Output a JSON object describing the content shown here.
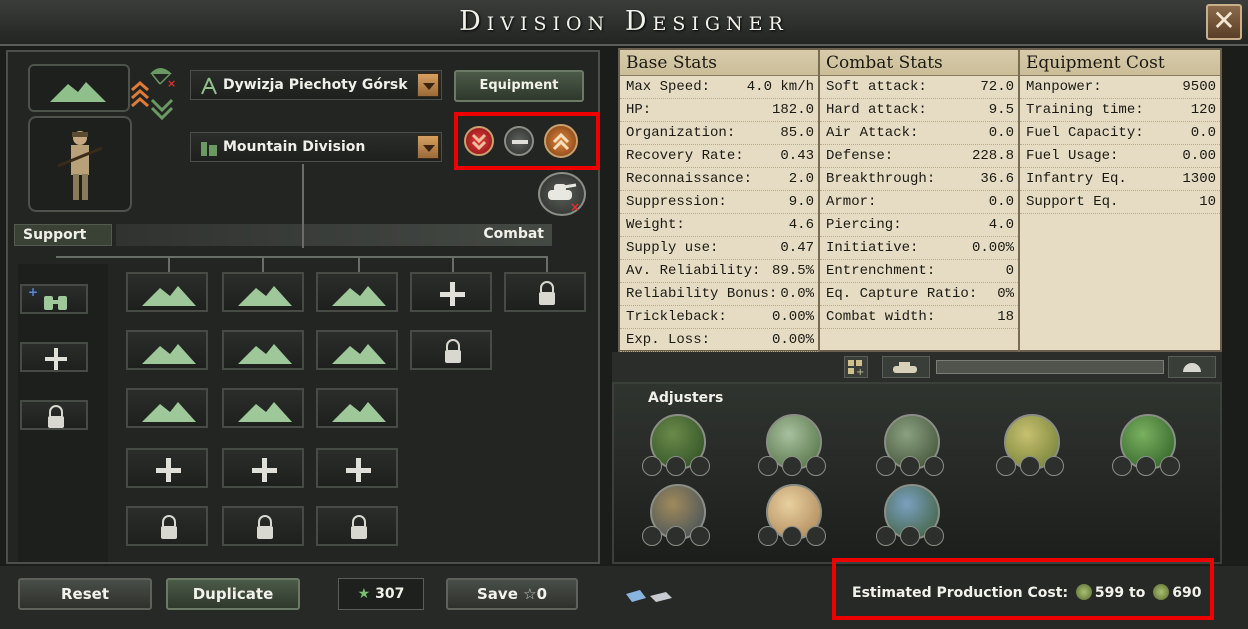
{
  "window": {
    "title": "Division Designer",
    "close_label": "✕"
  },
  "division": {
    "name": "Dywizja Piechoty Górsk",
    "template": "Mountain Division",
    "equipment_label": "Equipment"
  },
  "sections": {
    "support_label": "Support",
    "combat_label": "Combat",
    "adjusters_label": "Adjusters"
  },
  "base_stats": {
    "title": "Base Stats",
    "rows": [
      {
        "label": "Max Speed:",
        "value": "4.0 km/h"
      },
      {
        "label": "HP:",
        "value": "182.0"
      },
      {
        "label": "Organization:",
        "value": "85.0"
      },
      {
        "label": "Recovery Rate:",
        "value": "0.43"
      },
      {
        "label": "Reconnaissance:",
        "value": "2.0"
      },
      {
        "label": "Suppression:",
        "value": "9.0"
      },
      {
        "label": "Weight:",
        "value": "4.6"
      },
      {
        "label": "Supply use:",
        "value": "0.47"
      },
      {
        "label": "Av. Reliability:",
        "value": "89.5%"
      },
      {
        "label": "Reliability Bonus:",
        "value": "0.0%"
      },
      {
        "label": "Trickleback:",
        "value": "0.00%"
      },
      {
        "label": "Exp. Loss:",
        "value": "0.00%"
      }
    ]
  },
  "combat_stats": {
    "title": "Combat Stats",
    "rows": [
      {
        "label": "Soft attack:",
        "value": "72.0"
      },
      {
        "label": "Hard attack:",
        "value": "9.5"
      },
      {
        "label": "Air Attack:",
        "value": "0.0"
      },
      {
        "label": "Defense:",
        "value": "228.8"
      },
      {
        "label": "Breakthrough:",
        "value": "36.6"
      },
      {
        "label": "Armor:",
        "value": "0.0"
      },
      {
        "label": "Piercing:",
        "value": "4.0"
      },
      {
        "label": "Initiative:",
        "value": "0.00%"
      },
      {
        "label": "Entrenchment:",
        "value": "0"
      },
      {
        "label": "Eq. Capture Ratio:",
        "value": "0%"
      },
      {
        "label": "Combat width:",
        "value": "18"
      }
    ]
  },
  "equipment_cost": {
    "title": "Equipment Cost",
    "rows": [
      {
        "label": "Manpower:",
        "value": "9500"
      },
      {
        "label": "Training time:",
        "value": "120"
      },
      {
        "label": "Fuel Capacity:",
        "value": "0.0"
      },
      {
        "label": "Fuel Usage:",
        "value": "0.00"
      },
      {
        "label": "Infantry Eq.",
        "value": "1300"
      },
      {
        "label": "Support Eq.",
        "value": "10"
      }
    ]
  },
  "bottom": {
    "reset_label": "Reset",
    "duplicate_label": "Duplicate",
    "xp_value": "307",
    "save_label": "Save",
    "save_cost": "0",
    "production_label": "Estimated Production Cost:",
    "production_min": "599",
    "production_to": "to",
    "production_max": "690"
  },
  "colors": {
    "highlight_red": "#ee0000",
    "stats_background": "#e6dcc4",
    "mountain_green": "#8fbf8a",
    "accent_orange": "#d8a060"
  },
  "terrains": [
    "forest",
    "hills",
    "mountain",
    "plains",
    "jungle",
    "marsh",
    "desert",
    "river"
  ]
}
